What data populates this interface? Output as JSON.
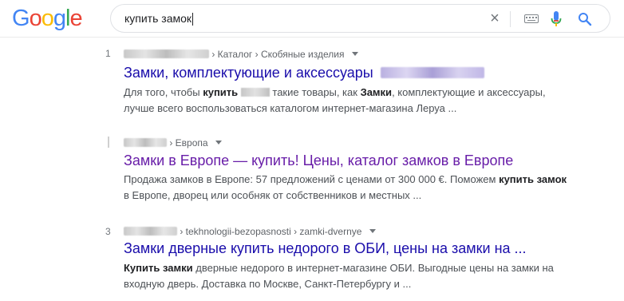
{
  "header": {
    "logo_letters": [
      "G",
      "o",
      "o",
      "g",
      "l",
      "e"
    ],
    "logo_colors": [
      "#4285F4",
      "#EA4335",
      "#FBBC05",
      "#4285F4",
      "#34A853",
      "#EA4335"
    ],
    "search_value": "купить замок",
    "clear_icon": "×"
  },
  "results": [
    {
      "number": "1",
      "breadcrumb_path": "› Каталог › Скобяные изделия",
      "title": "Замки, комплектующие и аксессуары",
      "snippet_a": "Для того, чтобы ",
      "snippet_b1": "купить",
      "snippet_c": " такие товары, как ",
      "snippet_b2": "Замки",
      "snippet_d": ", комплектующие и аксессуары, лучше всего воспользоваться каталогом интернет-магазина Леруа ..."
    },
    {
      "number": "",
      "breadcrumb_path": "› Европа",
      "title": "Замки в Европе — купить! Цены, каталог замков в Европе",
      "snippet_a": "Продажа замков в Европе: 57 предложений с ценами от 300 000 €. Поможем ",
      "snippet_b1": "купить замок",
      "snippet_d": " в Европе, дворец или особняк от собственников и местных ..."
    },
    {
      "number": "3",
      "breadcrumb_path": "› tekhnologii-bezopasnosti › zamki-dvernye",
      "title": "Замки дверные купить недорого в ОБИ, цены на замки на ...",
      "snippet_b1": "Купить замки",
      "snippet_d": " дверные недорого в интернет-магазине ОБИ. Выгодные цены на замки на входную дверь. Доставка по Москве, Санкт-Петербургу и ..."
    }
  ],
  "colors": {
    "link": "#1a0dab",
    "visited": "#681da8",
    "snippet": "#4d5156"
  }
}
